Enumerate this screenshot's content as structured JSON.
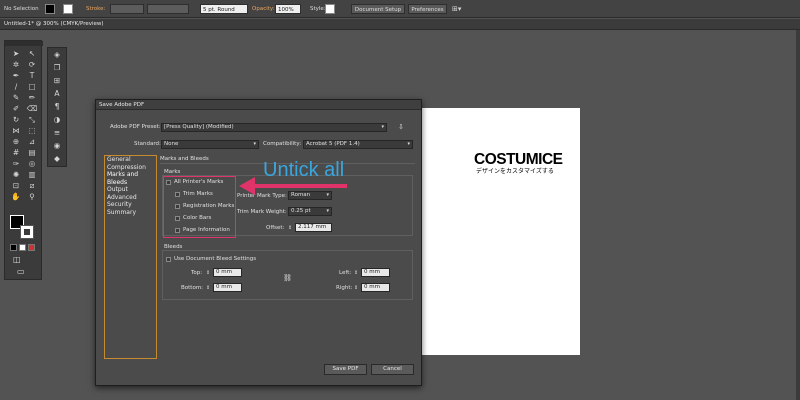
{
  "control_bar": {
    "selection": "No Selection",
    "stroke_label": "Stroke:",
    "brush_value": "5 pt. Round",
    "opacity_label": "Opacity:",
    "opacity_value": "100%",
    "style_label": "Style:",
    "doc_setup": "Document Setup",
    "preferences": "Preferences"
  },
  "doc_tab": {
    "title": "Untitled-1* @ 300% (CMYK/Preview)"
  },
  "artboard": {
    "logo": "COSTUMICE",
    "tagline": "デザインをカスタマイズする"
  },
  "annotation": {
    "text": "Untick all",
    "color": "#3aa6df",
    "highlight_color": "#e0336a"
  },
  "dialog": {
    "title": "Save Adobe PDF",
    "preset_label": "Adobe PDF Preset:",
    "preset_value": "[Press Quality] (Modified)",
    "standard_label": "Standard:",
    "standard_value": "None",
    "compat_label": "Compatibility:",
    "compat_value": "Acrobat 5 (PDF 1.4)",
    "side_items": [
      "General",
      "Compression",
      "Marks and Bleeds",
      "Output",
      "Advanced",
      "Security",
      "Summary"
    ],
    "section_title": "Marks and Bleeds",
    "marks": {
      "group_label": "Marks",
      "all": "All Printer's Marks",
      "items": [
        "Trim Marks",
        "Registration Marks",
        "Color Bars",
        "Page Information"
      ],
      "type_label": "Printer Mark Type:",
      "type_value": "Roman",
      "weight_label": "Trim Mark Weight:",
      "weight_value": "0.25 pt",
      "offset_label": "Offset:",
      "offset_value": "2.117 mm"
    },
    "bleeds": {
      "group_label": "Bleeds",
      "use_doc": "Use Document Bleed Settings",
      "top_label": "Top:",
      "top_value": "0 mm",
      "bottom_label": "Bottom:",
      "bottom_value": "0 mm",
      "left_label": "Left:",
      "left_value": "0 mm",
      "right_label": "Right:",
      "right_value": "0 mm"
    },
    "save_button": "Save PDF",
    "cancel_button": "Cancel"
  }
}
